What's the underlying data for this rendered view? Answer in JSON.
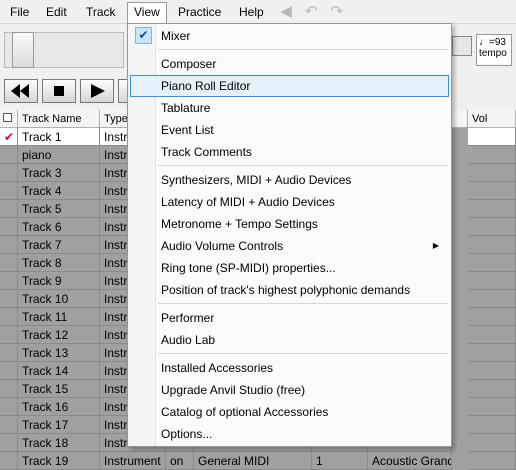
{
  "menubar": {
    "items": [
      "File",
      "Edit",
      "Track",
      "View",
      "Practice",
      "Help"
    ]
  },
  "toolbar": {
    "tempo_value": "♩=93",
    "tempo_label": "tempo"
  },
  "tracks": {
    "headers": [
      "Track Name",
      "Type",
      "Vol"
    ],
    "rows": [
      {
        "name": "Track 1",
        "type": "Instrument",
        "mode": "",
        "device": "",
        "ch": "",
        "sound": ""
      },
      {
        "name": "piano",
        "type": "Instrument",
        "mode": "",
        "device": "",
        "ch": "",
        "sound": ""
      },
      {
        "name": "Track 3",
        "type": "Instrument",
        "mode": "",
        "device": "",
        "ch": "",
        "sound": ""
      },
      {
        "name": "Track 4",
        "type": "Instrument",
        "mode": "",
        "device": "",
        "ch": "",
        "sound": ""
      },
      {
        "name": "Track 5",
        "type": "Instrument",
        "mode": "",
        "device": "",
        "ch": "",
        "sound": ""
      },
      {
        "name": "Track 6",
        "type": "Instrument",
        "mode": "",
        "device": "",
        "ch": "",
        "sound": ""
      },
      {
        "name": "Track 7",
        "type": "Instrument",
        "mode": "",
        "device": "",
        "ch": "",
        "sound": ""
      },
      {
        "name": "Track 8",
        "type": "Instrument",
        "mode": "",
        "device": "",
        "ch": "",
        "sound": ""
      },
      {
        "name": "Track 9",
        "type": "Instrument",
        "mode": "",
        "device": "",
        "ch": "",
        "sound": ""
      },
      {
        "name": "Track 10",
        "type": "Instrument",
        "mode": "",
        "device": "",
        "ch": "",
        "sound": ""
      },
      {
        "name": "Track 11",
        "type": "Instrument",
        "mode": "",
        "device": "",
        "ch": "",
        "sound": ""
      },
      {
        "name": "Track 12",
        "type": "Instrument",
        "mode": "",
        "device": "",
        "ch": "",
        "sound": ""
      },
      {
        "name": "Track 13",
        "type": "Instrument",
        "mode": "",
        "device": "",
        "ch": "",
        "sound": ""
      },
      {
        "name": "Track 14",
        "type": "Instrument",
        "mode": "",
        "device": "",
        "ch": "",
        "sound": ""
      },
      {
        "name": "Track 15",
        "type": "Instrument",
        "mode": "",
        "device": "",
        "ch": "",
        "sound": ""
      },
      {
        "name": "Track 16",
        "type": "Instrument",
        "mode": "",
        "device": "",
        "ch": "",
        "sound": ""
      },
      {
        "name": "Track 17",
        "type": "Instrument",
        "mode": "",
        "device": "",
        "ch": "",
        "sound": ""
      },
      {
        "name": "Track 18",
        "type": "Instrument",
        "mode": "",
        "device": "",
        "ch": "",
        "sound": ""
      },
      {
        "name": "Track 19",
        "type": "Instrument",
        "mode": "on",
        "device": "General MIDI",
        "ch": "1",
        "sound": "Acoustic Grand"
      }
    ]
  },
  "view_menu": {
    "items": [
      {
        "label": "Mixer",
        "checked": true
      },
      {
        "label": "Composer"
      },
      {
        "label": "Piano Roll Editor",
        "highlighted": true
      },
      {
        "label": "Tablature"
      },
      {
        "label": "Event List"
      },
      {
        "label": "Track Comments"
      },
      {
        "label": "Synthesizers, MIDI + Audio Devices"
      },
      {
        "label": "Latency of MIDI + Audio Devices"
      },
      {
        "label": "Metronome + Tempo Settings"
      },
      {
        "label": "Audio Volume Controls",
        "submenu": true
      },
      {
        "label": "Ring tone (SP-MIDI) properties..."
      },
      {
        "label": "Position of track's highest polyphonic demands"
      },
      {
        "label": "Performer"
      },
      {
        "label": "Audio Lab"
      },
      {
        "label": "Installed Accessories"
      },
      {
        "label": "Upgrade Anvil Studio (free)"
      },
      {
        "label": "Catalog of optional Accessories"
      },
      {
        "label": "Options..."
      }
    ]
  },
  "colors": {
    "highlight_bg": "#e5f1fb",
    "highlight_border": "#3b8ed8",
    "grid_bg": "#a0a0a0",
    "check_red": "#c8102e"
  },
  "icons": [
    "back-arrow-icon",
    "undo-icon",
    "redo-icon",
    "rewind-icon",
    "stop-icon",
    "play-icon",
    "checkmark-icon",
    "submenu-arrow-icon"
  ]
}
